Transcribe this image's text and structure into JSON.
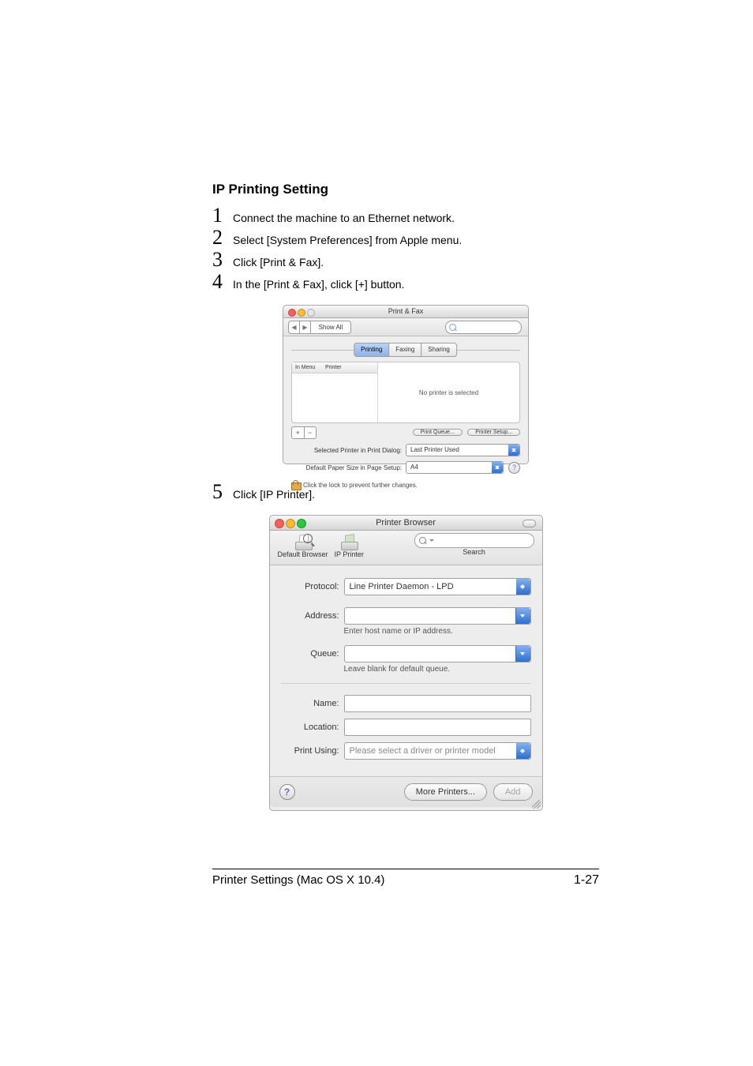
{
  "heading": "IP Printing Setting",
  "steps": {
    "s1": "Connect the machine to an Ethernet network.",
    "s2": "Select [System Preferences] from Apple menu.",
    "s3": "Click [Print & Fax].",
    "s4": "In the [Print & Fax], click [+] button.",
    "s5": "Click [IP Printer]."
  },
  "nums": {
    "n1": "1",
    "n2": "2",
    "n3": "3",
    "n4": "4",
    "n5": "5"
  },
  "printfax": {
    "title": "Print & Fax",
    "show_all": "Show All",
    "nav_back": "◀",
    "nav_fwd": "▶",
    "tabs": {
      "printing": "Printing",
      "faxing": "Faxing",
      "sharing": "Sharing"
    },
    "list_cols": {
      "c1": "In Menu",
      "c2": "Printer"
    },
    "no_printer": "No printer is selected",
    "plus": "+",
    "minus": "−",
    "print_queue": "Print Queue...",
    "printer_setup": "Printer Setup...",
    "row1_label": "Selected Printer in Print Dialog:",
    "row1_value": "Last Printer Used",
    "row2_label": "Default Paper Size in Page Setup:",
    "row2_value": "A4",
    "help": "?",
    "lock_text": "Click the lock to prevent further changes."
  },
  "browser": {
    "title": "Printer Browser",
    "default_browser": "Default Browser",
    "ip_printer": "IP Printer",
    "search": "Search",
    "labels": {
      "protocol": "Protocol:",
      "address": "Address:",
      "queue": "Queue:",
      "name": "Name:",
      "location": "Location:",
      "print_using": "Print Using:"
    },
    "protocol_value": "Line Printer Daemon - LPD",
    "address_hint": "Enter host name or IP address.",
    "queue_hint": "Leave blank for default queue.",
    "print_using_value": "Please select a driver or printer model",
    "more_printers": "More Printers...",
    "add": "Add",
    "help": "?"
  },
  "footer": {
    "left": "Printer Settings (Mac OS X 10.4)",
    "right": "1-27"
  }
}
